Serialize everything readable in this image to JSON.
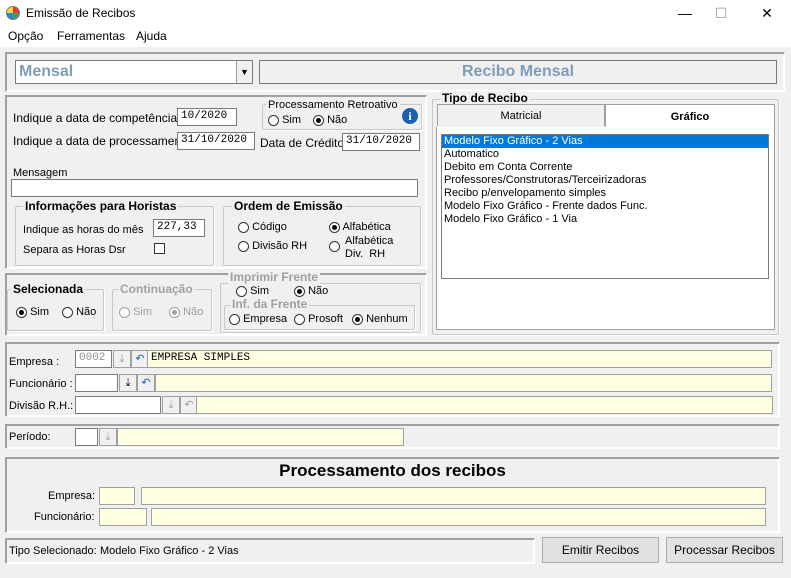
{
  "window": {
    "title": "Emissão de Recibos"
  },
  "menu": [
    "Opção",
    "Ferramentas",
    "Ajuda"
  ],
  "top": {
    "period_select": "Mensal",
    "receipt_title": "Recibo Mensal"
  },
  "dates": {
    "competencia_label": "Indique a data de competência",
    "competencia_value": "10/2020",
    "processamento_label": "Indique a data de processamento",
    "processamento_value": "31/10/2020",
    "credito_label": "Data de Crédito",
    "credito_value": "31/10/2020"
  },
  "retroativo": {
    "title": "Processamento Retroativo",
    "sim": "Sim",
    "nao": "Não",
    "selected": "Não"
  },
  "mensagem": {
    "label": "Mensagem",
    "value": ""
  },
  "horistas": {
    "title": "Informações para Horistas",
    "horas_label": "Indique as horas do mês",
    "horas_value": "227,33",
    "separa_label": "Separa as Horas Dsr"
  },
  "ordem": {
    "title": "Ordem de Emissão",
    "codigo": "Código",
    "divisao": "Divisão RH",
    "alfabetica": "Alfabética",
    "alfabetica_div_1": "Alfabética",
    "alfabetica_div_2": "Div.  RH",
    "selected": "Alfabética"
  },
  "selecionada": {
    "title": "Selecionada",
    "sim": "Sim",
    "nao": "Não",
    "selected": "Sim"
  },
  "continuacao": {
    "title": "Continuação",
    "sim": "Sim",
    "nao": "Não",
    "selected": "Não"
  },
  "imprimir_frente": {
    "title": "Imprimir Frente",
    "sim": "Sim",
    "nao": "Não",
    "selected": "Não"
  },
  "inf_frente": {
    "title": "Inf. da Frente",
    "empresa": "Empresa",
    "prosoft": "Prosoft",
    "nenhum": "Nenhum",
    "selected": "Nenhum"
  },
  "tipo_recibo": {
    "title": "Tipo de Recibo",
    "tabs": [
      "Matricial",
      "Gráfico"
    ],
    "active_tab": "Gráfico",
    "items": [
      "Modelo Fixo Gráfico - 2 Vias",
      "Automatico",
      "Debito em Conta Corrente",
      "Professores/Construtoras/Terceirizadoras",
      "Recibo p/envelopamento simples",
      "Modelo Fixo Gráfico - Frente dados Func.",
      "Modelo Fixo Gráfico - 1 Via"
    ],
    "selected_index": 0
  },
  "filters": {
    "empresa_label": "Empresa :",
    "empresa_code": "0002",
    "empresa_name": "EMPRESA SIMPLES",
    "funcionario_label": "Funcionário :",
    "funcionario_code": "",
    "funcionario_name": "",
    "divisao_label": "Divisão R.H.:",
    "divisao_code": "",
    "divisao_name": "",
    "periodo_label": "Período:",
    "periodo_code": "",
    "periodo_name": ""
  },
  "processamento": {
    "title": "Processamento dos recibos",
    "empresa_label": "Empresa:",
    "funcionario_label": "Funcionário:"
  },
  "status": {
    "tipo_label": "Tipo Selecionado:",
    "tipo_value": "Modelo Fixo Gráfico - 2 Vias",
    "emitir_button": "Emitir Recibos",
    "processar_button": "Processar Recibos"
  },
  "colors": {
    "accent": "#0078d7",
    "field_yellow": "#ffffe1",
    "title_blue": "#7f9db9"
  }
}
